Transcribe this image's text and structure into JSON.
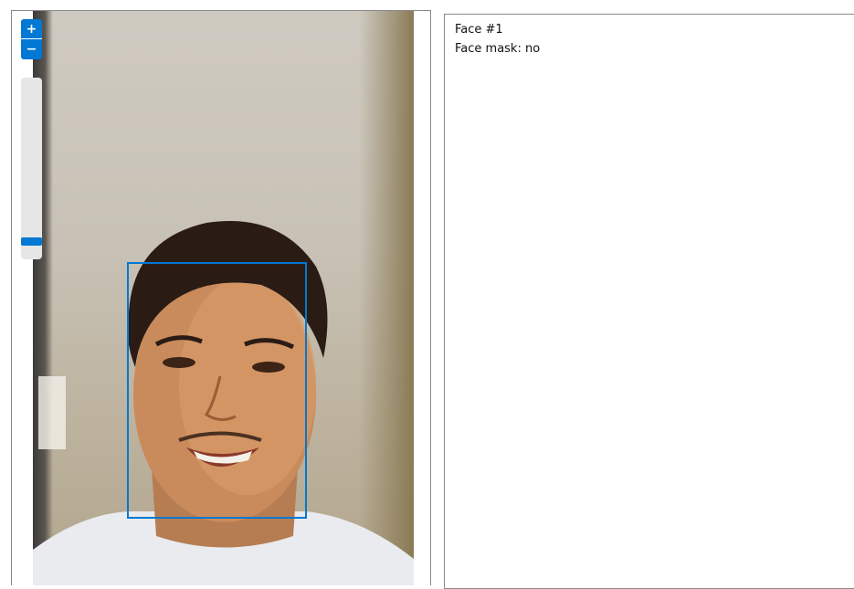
{
  "image_viewer": {
    "zoom_in_label": "+",
    "zoom_out_label": "−",
    "zoom_level": 0.08,
    "detection_color": "#0078d4"
  },
  "results": {
    "face_title": "Face #1",
    "face_mask": "Face mask: no"
  }
}
